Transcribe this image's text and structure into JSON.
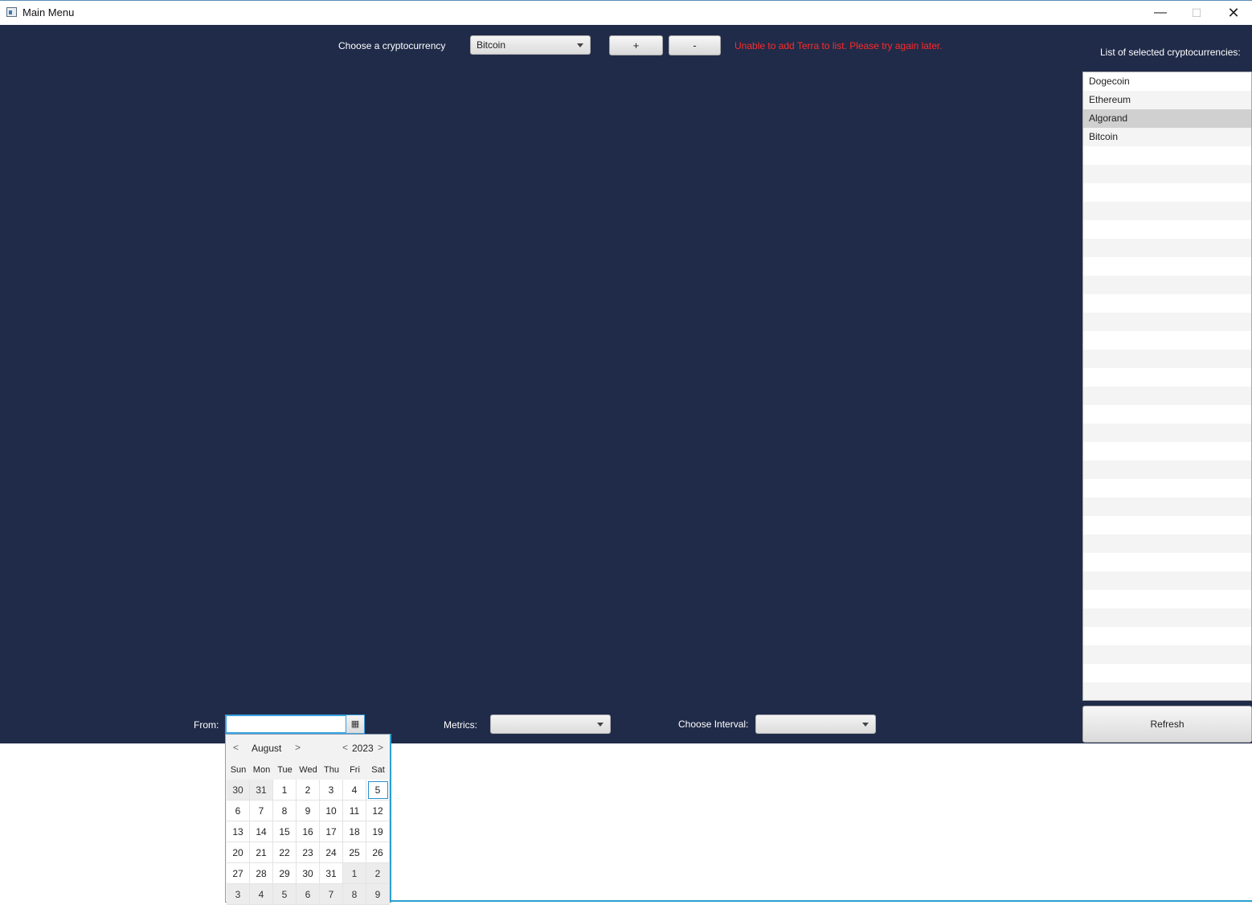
{
  "window": {
    "title": "Main Menu",
    "minimize": "—",
    "maximize": "☐",
    "close": "✕"
  },
  "top": {
    "choose_label": "Choose a cryptocurrency",
    "crypto_selected": "Bitcoin",
    "add_label": "+",
    "remove_label": "-",
    "error_message": "Unable to add Terra to list. Please try again later."
  },
  "list": {
    "heading": "List of selected cryptocurrencies:",
    "items": [
      "Dogecoin",
      "Ethereum",
      "Algorand",
      "Bitcoin"
    ],
    "selected_index": 2
  },
  "refresh_label": "Refresh",
  "bottom": {
    "from_label": "From:",
    "from_value": "",
    "metrics_label": "Metrics:",
    "metrics_value": "",
    "interval_label": "Choose Interval:",
    "interval_value": ""
  },
  "calendar": {
    "month": "August",
    "year": "2023",
    "prev": "<",
    "next": ">",
    "weekdays": [
      "Sun",
      "Mon",
      "Tue",
      "Wed",
      "Thu",
      "Fri",
      "Sat"
    ],
    "weeks": [
      [
        "30",
        "31",
        "1",
        "2",
        "3",
        "4",
        "5"
      ],
      [
        "6",
        "7",
        "8",
        "9",
        "10",
        "11",
        "12"
      ],
      [
        "13",
        "14",
        "15",
        "16",
        "17",
        "18",
        "19"
      ],
      [
        "20",
        "21",
        "22",
        "23",
        "24",
        "25",
        "26"
      ],
      [
        "27",
        "28",
        "29",
        "30",
        "31",
        "1",
        "2"
      ],
      [
        "3",
        "4",
        "5",
        "6",
        "7",
        "8",
        "9"
      ]
    ],
    "today": "5"
  },
  "colors": {
    "background": "#202b49",
    "error": "#ff2a2a",
    "focus": "#3aa0e0"
  }
}
